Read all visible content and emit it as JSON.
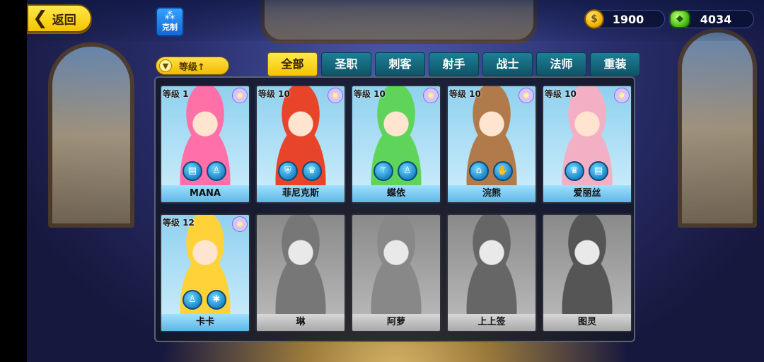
{
  "header": {
    "back_label": "返回",
    "counter_label": "克制"
  },
  "currency": {
    "gold": "1900",
    "gems": "4034"
  },
  "sort": {
    "label": "等级↑"
  },
  "tabs": [
    "全部",
    "圣职",
    "刺客",
    "射手",
    "战士",
    "法师",
    "重装"
  ],
  "active_tab": "全部",
  "heroes": [
    {
      "name": "MANA",
      "level": "等级 1",
      "owned": true,
      "skills": [
        "book-icon",
        "figure-icon"
      ],
      "color": "#ff6fa8"
    },
    {
      "name": "菲尼克斯",
      "level": "等级 10",
      "owned": true,
      "skills": [
        "shield-icon",
        "crown-icon"
      ],
      "color": "#e8442a"
    },
    {
      "name": "蝶依",
      "level": "等级 10",
      "owned": true,
      "skills": [
        "wand-icon",
        "figure-icon"
      ],
      "color": "#5ed45a"
    },
    {
      "name": "浣熊",
      "level": "等级 10",
      "owned": true,
      "skills": [
        "hat-icon",
        "glove-icon"
      ],
      "color": "#b07a4a"
    },
    {
      "name": "爱丽丝",
      "level": "等级 10",
      "owned": true,
      "skills": [
        "crown-icon",
        "book-icon"
      ],
      "color": "#f3b0c4"
    },
    {
      "name": "卡卡",
      "level": "等级 12",
      "owned": true,
      "skills": [
        "figure-icon",
        "bug-icon"
      ],
      "color": "#ffd23a"
    },
    {
      "name": "琳",
      "level": "",
      "owned": false,
      "skills": [],
      "color": "#777"
    },
    {
      "name": "阿萝",
      "level": "",
      "owned": false,
      "skills": [],
      "color": "#888"
    },
    {
      "name": "上上签",
      "level": "",
      "owned": false,
      "skills": [],
      "color": "#666"
    },
    {
      "name": "图灵",
      "level": "",
      "owned": false,
      "skills": [],
      "color": "#555"
    }
  ]
}
